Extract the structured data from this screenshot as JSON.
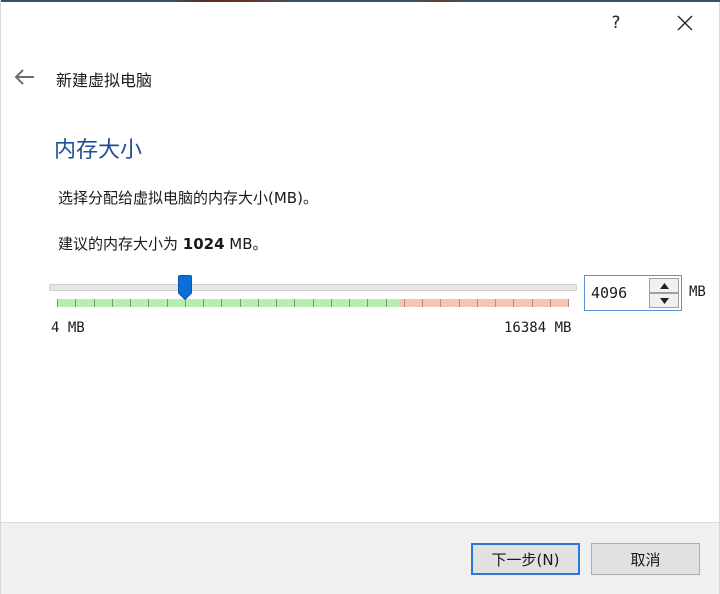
{
  "window": {
    "help_label": "?",
    "close_icon": "close-icon",
    "back_icon": "arrow-left-icon"
  },
  "wizard": {
    "title": "新建虚拟电脑"
  },
  "page": {
    "title": "内存大小",
    "description": "选择分配给虚拟电脑的内存大小(MB)。",
    "recommend_prefix": "建议的内存大小为 ",
    "recommend_value": "1024",
    "recommend_suffix": " MB。"
  },
  "memory": {
    "value": "4096",
    "unit": "MB",
    "min_label": "4 MB",
    "max_label": "16384 MB",
    "min": 4,
    "max": 16384,
    "current": 4096,
    "green_until_fraction": 0.67,
    "tick_count": 28
  },
  "colors": {
    "accent": "#1e4e96",
    "handle": "#0a6fd6",
    "safe_zone": "#b8efb0",
    "warn_zone": "#f7c3b6",
    "focus_border": "#2a78d8"
  },
  "footer": {
    "next_label": "下一步(N)",
    "cancel_label": "取消"
  }
}
